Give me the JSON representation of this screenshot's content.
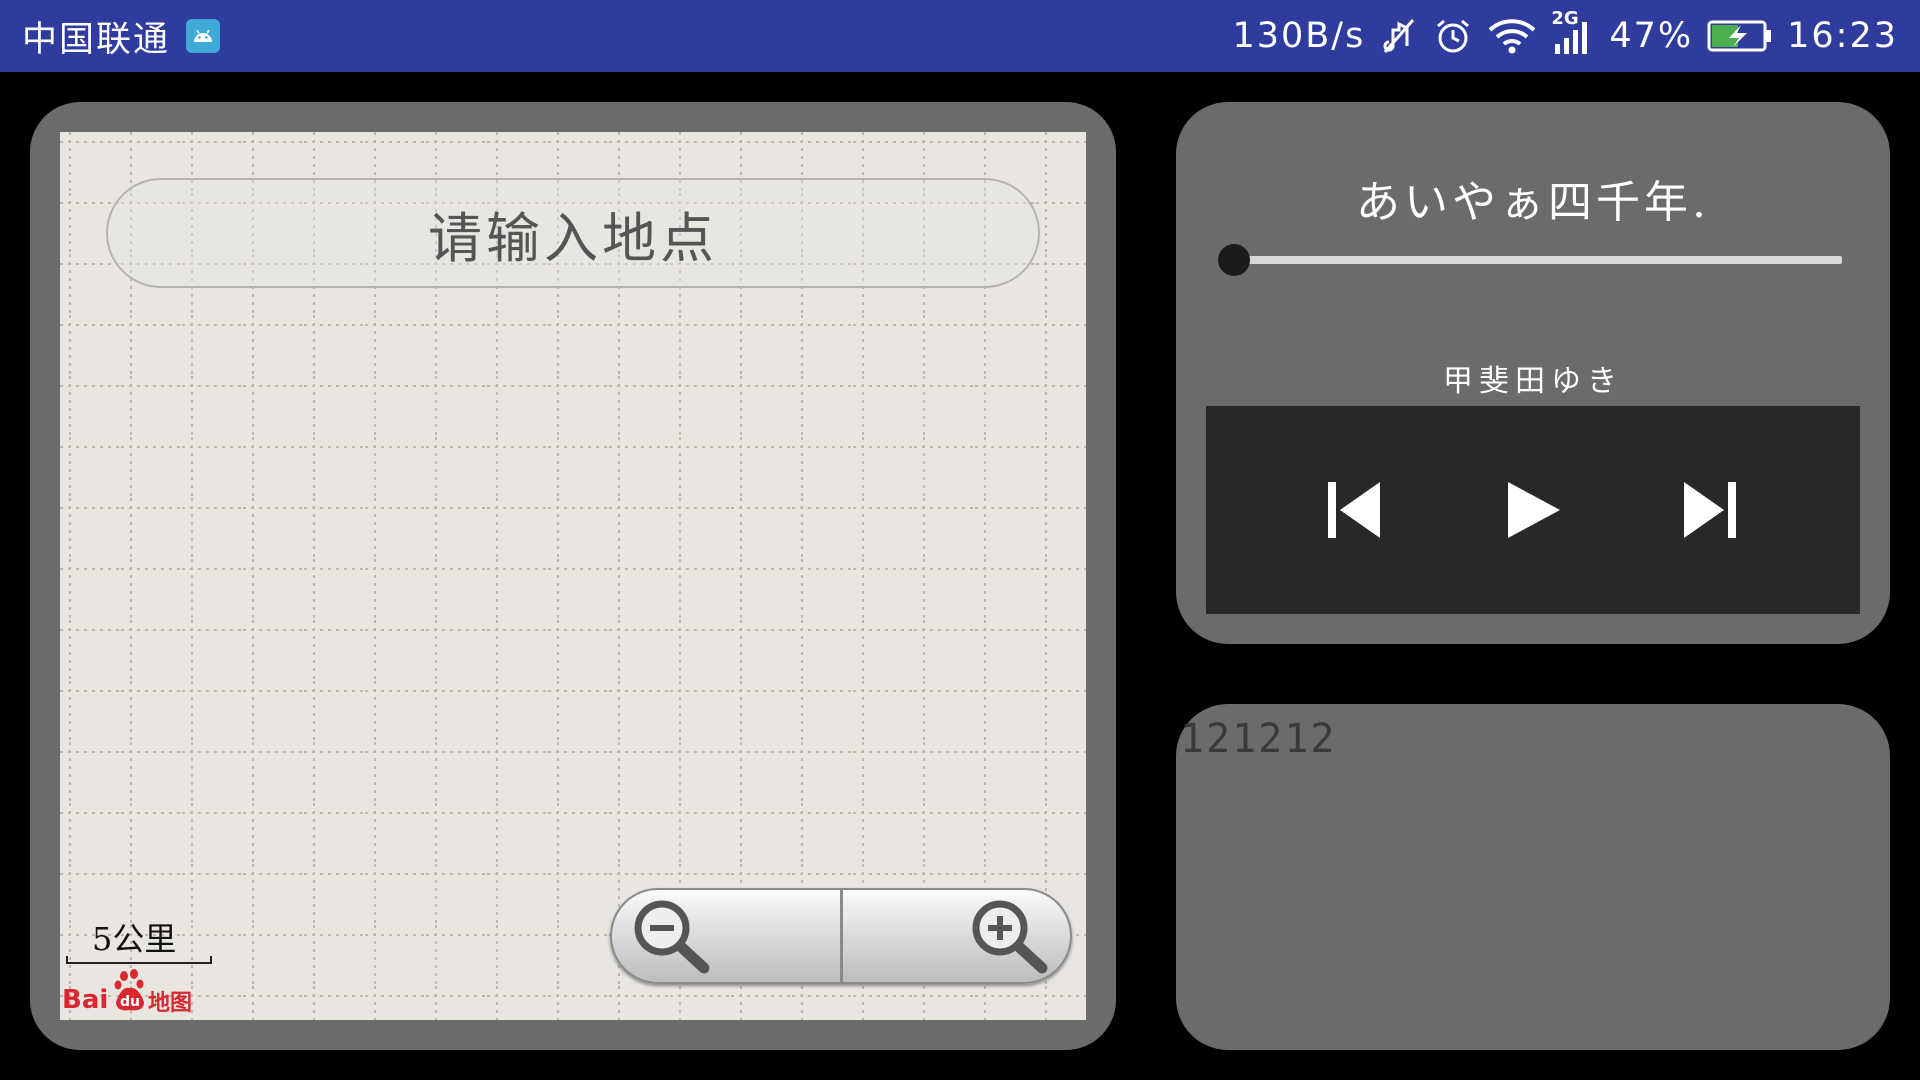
{
  "status_bar": {
    "carrier": "中国联通",
    "net_speed": "130B/s",
    "network_type": "2G",
    "battery": "47%",
    "time": "16:23",
    "icons": [
      "android-notification-icon",
      "mute-icon",
      "alarm-icon",
      "wifi-icon",
      "signal-icon",
      "battery-charging-icon"
    ]
  },
  "map": {
    "search_placeholder": "请输入地点",
    "scale_label": "5公里",
    "logo_text": "Baidu地图",
    "zoom_out_icon": "zoom-out-icon",
    "zoom_in_icon": "zoom-in-icon"
  },
  "player": {
    "song_title": "あいやぁ四千年.",
    "artist": "甲斐田ゆき",
    "progress": 0.0,
    "controls": [
      "previous-icon",
      "play-icon",
      "next-icon"
    ]
  },
  "bottom_panel": {
    "text": "121212"
  },
  "colors": {
    "status_bar": "#2f3c9e",
    "card": "#6b6b6b",
    "map_bg": "#e9e6e1",
    "controls_bg": "#272828",
    "background": "#000000"
  }
}
